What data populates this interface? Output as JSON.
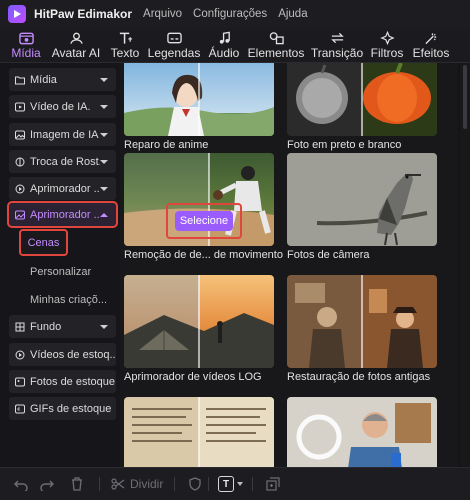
{
  "app": {
    "name": "HitPaw Edimakor"
  },
  "menu": [
    "Arquivo",
    "Configurações",
    "Ajuda"
  ],
  "toolbar": {
    "tabs": [
      {
        "label": "Mídia",
        "icon": "media-folder-icon",
        "active": true
      },
      {
        "label": "Avatar AI",
        "icon": "avatar-icon"
      },
      {
        "label": "Texto",
        "icon": "text-icon"
      },
      {
        "label": "Legendas",
        "icon": "subtitles-icon"
      },
      {
        "label": "Áudio",
        "icon": "music-note-icon"
      },
      {
        "label": "Elementos",
        "icon": "elements-icon"
      },
      {
        "label": "Transição",
        "icon": "transition-icon"
      },
      {
        "label": "Filtros",
        "icon": "filters-icon"
      },
      {
        "label": "Efeitos",
        "icon": "effects-icon"
      }
    ]
  },
  "sidebar": {
    "items": [
      {
        "label": "Mídia",
        "icon": "folder-icon"
      },
      {
        "label": "Vídeo de IA.",
        "icon": "video-icon"
      },
      {
        "label": "Imagem de IA",
        "icon": "image-icon"
      },
      {
        "label": "Troca de Rost...",
        "icon": "face-swap-icon"
      },
      {
        "label": "Aprimorador ...",
        "icon": "enhancer-icon"
      },
      {
        "label": "Aprimorador ...",
        "icon": "image-enhancer-icon",
        "active": true
      },
      {
        "label": "Fundo",
        "icon": "background-icon"
      },
      {
        "label": "Vídeos de estoq...",
        "icon": "stock-video-icon"
      },
      {
        "label": "Fotos de estoque",
        "icon": "stock-photo-icon"
      },
      {
        "label": "GIFs de estoque",
        "icon": "gif-icon"
      }
    ],
    "subitems": [
      {
        "label": "Cenas",
        "selected": true
      },
      {
        "label": "Personalizar"
      },
      {
        "label": "Minhas criaçõ..."
      }
    ]
  },
  "cards": [
    {
      "caption": "Reparo de anime"
    },
    {
      "caption": "Foto em preto e branco"
    },
    {
      "caption": "Remoção de de... de movimento",
      "hover_button": "Selecione"
    },
    {
      "caption": "Fotos de câmera"
    },
    {
      "caption": "Aprimorador de vídeos LOG"
    },
    {
      "caption": "Restauração de fotos antigas"
    },
    {
      "caption": ""
    },
    {
      "caption": ""
    }
  ],
  "bottombar": {
    "split_label": "Dividir",
    "text_button": "T"
  },
  "colors": {
    "accent": "#c48cff",
    "highlight": "#e0463d",
    "button": "#9b5cff"
  }
}
